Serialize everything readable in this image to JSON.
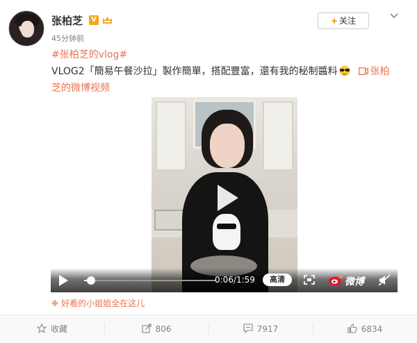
{
  "post": {
    "author": "张柏芝",
    "verified_badge": "V",
    "time_ago": "45分钟前",
    "follow_label": "关注",
    "topic": "#张柏芝的vlog#",
    "body_text": "VLOG2「簡易午餐沙拉」製作簡單，搭配豐富，還有我的秘制醬料",
    "video_link_text": "张柏芝的微博视频",
    "caption": "好看的小姐姐全在这儿"
  },
  "video": {
    "timecode": "0:06/1:59",
    "progress": 0.05,
    "quality_label": "高清",
    "brand": "微博"
  },
  "actions": [
    {
      "icon": "star-icon",
      "label": "收藏"
    },
    {
      "icon": "share-icon",
      "label": "806"
    },
    {
      "icon": "comment-icon",
      "label": "7917"
    },
    {
      "icon": "like-icon",
      "label": "6834"
    }
  ],
  "colors": {
    "accent": "#eb7350",
    "follow_plus": "#ff8200",
    "badge": "#f5a623"
  }
}
